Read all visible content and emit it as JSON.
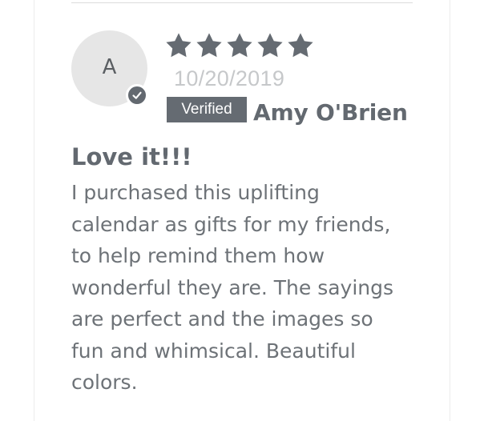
{
  "review": {
    "avatar_initial": "A",
    "rating": {
      "value": 5,
      "max": 5,
      "stars": [
        "star",
        "star",
        "star",
        "star",
        "star"
      ]
    },
    "date": "10/20/2019",
    "verified_badge": "Verified",
    "reviewer_name": "Amy O'Brien",
    "title": "Love it!!!",
    "body_lines": [
      "I purchased this uplifting",
      "calendar as gifts for my friends,",
      "to help remind them how",
      "wonderful they are. The sayings",
      "are perfect and the images so",
      "fun and whimsical. Beautiful",
      "colors."
    ]
  },
  "colors": {
    "star": "#656b72",
    "badge_bg": "#656b72",
    "text": "#636970",
    "date": "#c6c8ca",
    "avatar_bg": "#e6e6e6"
  },
  "icons": {
    "star": "star-icon",
    "check": "check-icon"
  }
}
